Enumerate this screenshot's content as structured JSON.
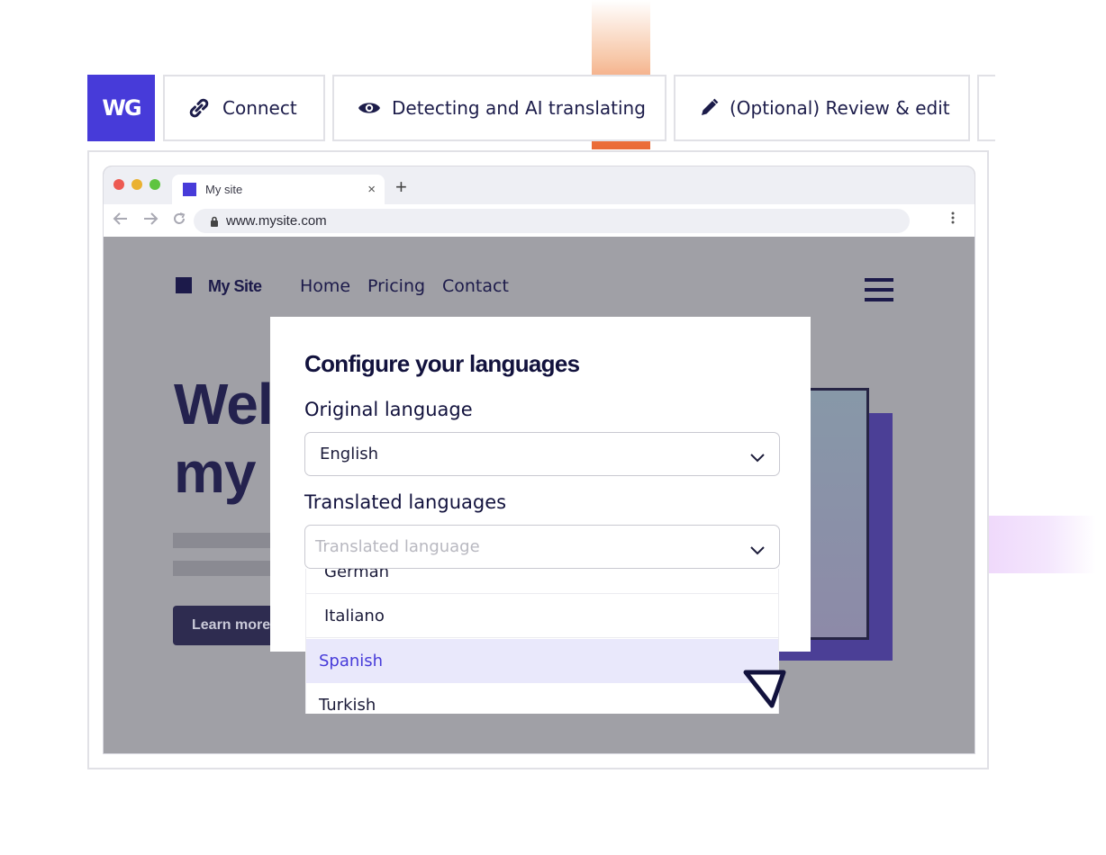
{
  "logo": {
    "text": "WG"
  },
  "steps": [
    {
      "label": "Connect",
      "icon": "link-icon"
    },
    {
      "label": "Detecting and AI translating",
      "icon": "eye-icon"
    },
    {
      "label": "(Optional) Review & edit",
      "icon": "pencil-icon"
    }
  ],
  "browser": {
    "tab_title": "My site",
    "tab_close": "×",
    "new_tab": "+",
    "url": "www.mysite.com"
  },
  "site": {
    "name": "My Site",
    "nav": [
      "Home",
      "Pricing",
      "Contact"
    ],
    "hero_line1": "Wel",
    "hero_line2": "my v",
    "cta_label": "Learn more"
  },
  "modal": {
    "title": "Configure your languages",
    "original_label": "Original language",
    "original_value": "English",
    "translated_label": "Translated languages",
    "translated_placeholder": "Translated language",
    "options": [
      "German",
      "Italiano",
      "Spanish",
      "Turkish"
    ],
    "selected_option": "Spanish"
  },
  "colors": {
    "brand": "#473bd9",
    "accent_orange": "#ea6a35",
    "selected_bg": "#e9e8fb"
  }
}
